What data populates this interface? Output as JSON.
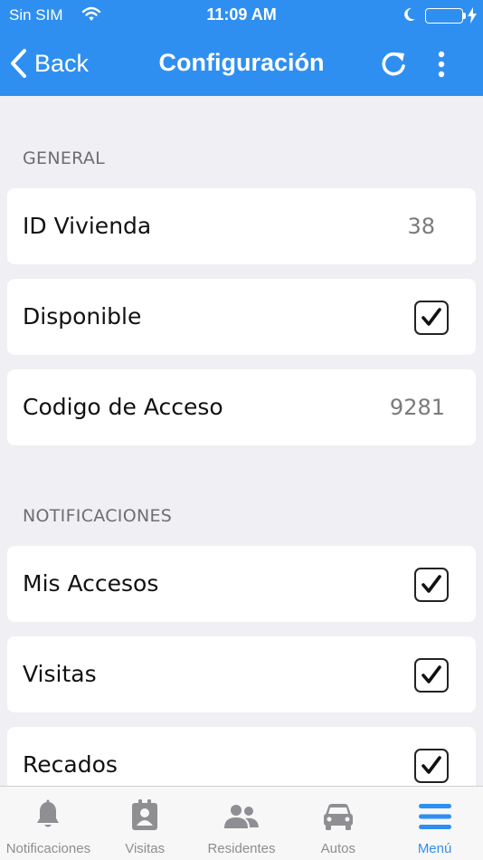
{
  "status_bar": {
    "carrier": "Sin SIM",
    "time": "11:09 AM",
    "battery_color": "#4cd964"
  },
  "nav": {
    "back_label": "Back",
    "title": "Configuración",
    "color": "#2f8ff0"
  },
  "sections": [
    {
      "header": "GENERAL",
      "rows": [
        {
          "label": "ID Vivienda",
          "value": "38"
        },
        {
          "label": "Disponible",
          "checked": true
        },
        {
          "label": "Codigo de Acceso",
          "value": "9281"
        }
      ]
    },
    {
      "header": "NOTIFICACIONES",
      "rows": [
        {
          "label": "Mis Accesos",
          "checked": true
        },
        {
          "label": "Visitas",
          "checked": true
        },
        {
          "label": "Recados",
          "checked": true
        }
      ]
    }
  ],
  "tabs": [
    {
      "label": "Notificaciones",
      "icon": "bell-icon",
      "active": false
    },
    {
      "label": "Visitas",
      "icon": "badge-icon",
      "active": false
    },
    {
      "label": "Residentes",
      "icon": "people-icon",
      "active": false
    },
    {
      "label": "Autos",
      "icon": "car-icon",
      "active": false
    },
    {
      "label": "Menú",
      "icon": "menu-icon",
      "active": true
    }
  ],
  "colors": {
    "accent": "#2f8ff0",
    "background": "#efeff4",
    "inactive_tab": "#8e8e93"
  }
}
